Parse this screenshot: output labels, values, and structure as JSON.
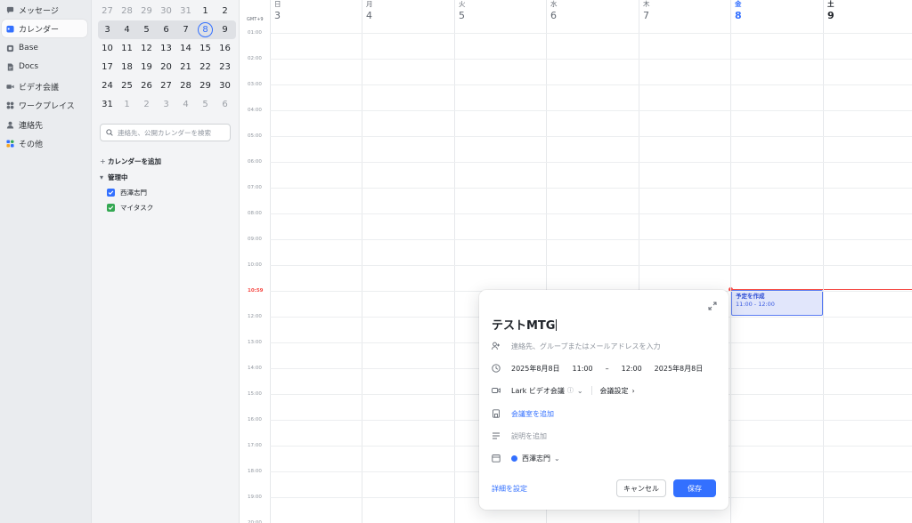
{
  "nav": {
    "items": [
      {
        "label": "メッセージ",
        "icon": "chat-bubble-icon"
      },
      {
        "label": "カレンダー",
        "icon": "calendar-icon"
      },
      {
        "label": "Base",
        "icon": "base-icon"
      },
      {
        "label": "Docs",
        "icon": "docs-icon"
      },
      {
        "label": "ビデオ会議",
        "icon": "video-camera-icon"
      },
      {
        "label": "ワークプレイス",
        "icon": "workplace-grid-icon"
      },
      {
        "label": "連絡先",
        "icon": "person-icon"
      },
      {
        "label": "その他",
        "icon": "more-apps-icon"
      }
    ],
    "active_index": 1
  },
  "mini_calendar": {
    "weeks": [
      [
        "27",
        "28",
        "29",
        "30",
        "31",
        "1",
        "2"
      ],
      [
        "3",
        "4",
        "5",
        "6",
        "7",
        "8",
        "9"
      ],
      [
        "10",
        "11",
        "12",
        "13",
        "14",
        "15",
        "16"
      ],
      [
        "17",
        "18",
        "19",
        "20",
        "21",
        "22",
        "23"
      ],
      [
        "24",
        "25",
        "26",
        "27",
        "28",
        "29",
        "30"
      ],
      [
        "31",
        "1",
        "2",
        "3",
        "4",
        "5",
        "6"
      ]
    ],
    "today": "8"
  },
  "search": {
    "placeholder": "連絡先、公開カレンダーを検索"
  },
  "sidebar": {
    "add_calendar": "カレンダーを追加",
    "managed_label": "管理中",
    "calendars": [
      {
        "label": "西澤志門",
        "color": "#3370ff"
      },
      {
        "label": "マイタスク",
        "color": "#34a853"
      }
    ]
  },
  "week": {
    "timezone": "GMT+9",
    "days": [
      {
        "dow": "日",
        "num": "3"
      },
      {
        "dow": "月",
        "num": "4"
      },
      {
        "dow": "火",
        "num": "5"
      },
      {
        "dow": "水",
        "num": "6"
      },
      {
        "dow": "木",
        "num": "7"
      },
      {
        "dow": "金",
        "num": "8"
      },
      {
        "dow": "土",
        "num": "9"
      }
    ],
    "hours": [
      "01:00",
      "02:00",
      "03:00",
      "04:00",
      "05:00",
      "06:00",
      "07:00",
      "08:00",
      "09:00",
      "10:00",
      "10:59",
      "12:00",
      "13:00",
      "14:00",
      "15:00",
      "16:00",
      "17:00",
      "18:00",
      "19:00",
      "20:00"
    ],
    "now_label": "10:59"
  },
  "event": {
    "title": "予定を作成",
    "time": "11:00 - 12:00"
  },
  "popup": {
    "title": "テストMTG",
    "guests_placeholder": "連絡先、グループまたはメールアドレスを入力",
    "start_date": "2025年8月8日",
    "start_time": "11:00",
    "dash": "–",
    "end_time": "12:00",
    "end_date": "2025年8月8日",
    "video": "Lark ビデオ会議",
    "info_glyph": "ⓘ",
    "meeting_settings": "会議設定",
    "add_room": "会議室を追加",
    "add_description": "説明を追加",
    "calendar_owner": "西澤志門",
    "details_link": "詳細を設定",
    "cancel": "キャンセル",
    "save": "保存"
  },
  "colors": {
    "accent": "#3370ff",
    "now_indicator": "#f54a45",
    "event_fill": "#e1e6fb"
  }
}
